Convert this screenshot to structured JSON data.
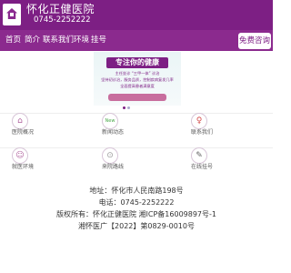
{
  "header": {
    "brand_name": "怀化正健医院",
    "phone": "0745-2252222",
    "logo": "hospital-house-cross-logo",
    "colors": {
      "primary": "#7d1f84",
      "nav": "#8b2a8e"
    }
  },
  "nav": {
    "items": [
      {
        "label": "首页"
      },
      {
        "label": "简介"
      },
      {
        "label": "联系我们"
      },
      {
        "label": "环境"
      },
      {
        "label": "挂号"
      }
    ],
    "consult_label": "免费咨询"
  },
  "banner": {
    "tagline": "专注你的健康",
    "line1": "主任坐诊 “三甲一体” 诊治",
    "line2": "坚持初诊治，服务品质，控制疾病复发几率",
    "line3": "全面提高患者满意度",
    "active_slide": 1,
    "slide_count": 2
  },
  "menu": {
    "items": [
      {
        "label": "医院概况",
        "icon": "home-icon"
      },
      {
        "label": "新闻动态",
        "icon": "news-icon"
      },
      {
        "label": "联系我们",
        "icon": "person-icon"
      },
      {
        "label": "就医环境",
        "icon": "environment-icon"
      },
      {
        "label": "来院路线",
        "icon": "route-icon"
      },
      {
        "label": "在线挂号",
        "icon": "register-icon"
      }
    ]
  },
  "footer": {
    "address": "地址：怀化市人民南路198号",
    "phone": "电话：0745-2252222",
    "copyright": "版权所有：怀化正健医院 湘ICP备16009897号-1",
    "license": "湘怀医广【2022】第0829-0010号"
  }
}
